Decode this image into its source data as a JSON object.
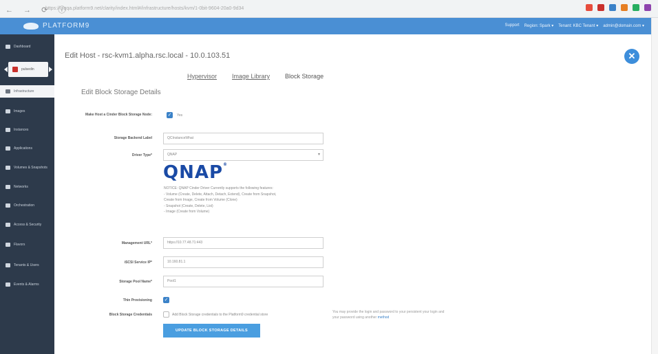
{
  "browser": {
    "nav": "← → ⟳ ⓘ",
    "url": "https://uiqqa.platform9.net/clarity/index.html#/infrastructure/hosts/kvm/1-0bit-9604-20a0-9d34",
    "extension_colors": [
      "#e74c3c",
      "#c9302c",
      "#3b82c8",
      "#e67e22",
      "#27ae60",
      "#8e44ad"
    ]
  },
  "app": {
    "brand": "PLATFORM9",
    "header_links": [
      "Support",
      "Region: Spark ▾",
      "Tenant: KBC Tenant ▾",
      "admin@domain.com ▾"
    ]
  },
  "sidebar": {
    "items": [
      {
        "label": "Dashboard"
      },
      {
        "label": "pulsedin"
      },
      {
        "label": "Infrastructure"
      },
      {
        "label": "Images"
      },
      {
        "label": "Instances"
      },
      {
        "label": "Applications"
      },
      {
        "label": "Volumes & Snapshots"
      },
      {
        "label": "Networks"
      },
      {
        "label": "Orchestration"
      },
      {
        "label": "Access & Security"
      },
      {
        "label": "Flavors"
      },
      {
        "label": "Tenants & Users"
      },
      {
        "label": "Events & Alarms"
      }
    ]
  },
  "page": {
    "title": "Edit Host - rsc-kvm1.alpha.rsc.local - 10.0.103.51",
    "close_icon": "✕",
    "tabs": [
      "Hypervisor",
      "Image Library",
      "Block Storage"
    ],
    "section_title": "Edit Block Storage Details"
  },
  "form": {
    "make_node_label": "Make Host a Cinder Block Storage Node:",
    "make_node_value": "Yes",
    "backend_label_label": "Storage Backend Label",
    "backend_label_value": "QCInstanceWhat",
    "driver_label": "Driver Type*",
    "driver_value": "QNAP",
    "driver_caret": "▾",
    "qnap_logo": "QNAP",
    "notice_lines": [
      "NOTICE: QNAP Cinder Driver Currently supports the following features:",
      "- Volume (Create, Delete, Attach, Detach, Extend), Create from Snapshot,",
      "  Create from Image, Create from Volume (Clone)",
      "- Snapshot (Create, Delete, List)",
      "- Image (Create from Volume)"
    ],
    "management_url_label": "Management URL*",
    "management_url_value": "https://10.77.48.71:443",
    "iscsi_label": "iSCSI Service IP*",
    "iscsi_value": "10.160.81.1",
    "pool_label": "Storage Pool Name*",
    "pool_value": "Pool1",
    "thin_label": "Thin Provisioning",
    "credentials_label": "Block Storage Credentials",
    "credentials_text": "Add Block Storage credentials to the Platform9 credential store",
    "hint_text": "You may provide the login and password to your persistent your login and your password using another",
    "hint_link": "method",
    "submit_label": "UPDATE BLOCK STORAGE DETAILS"
  }
}
